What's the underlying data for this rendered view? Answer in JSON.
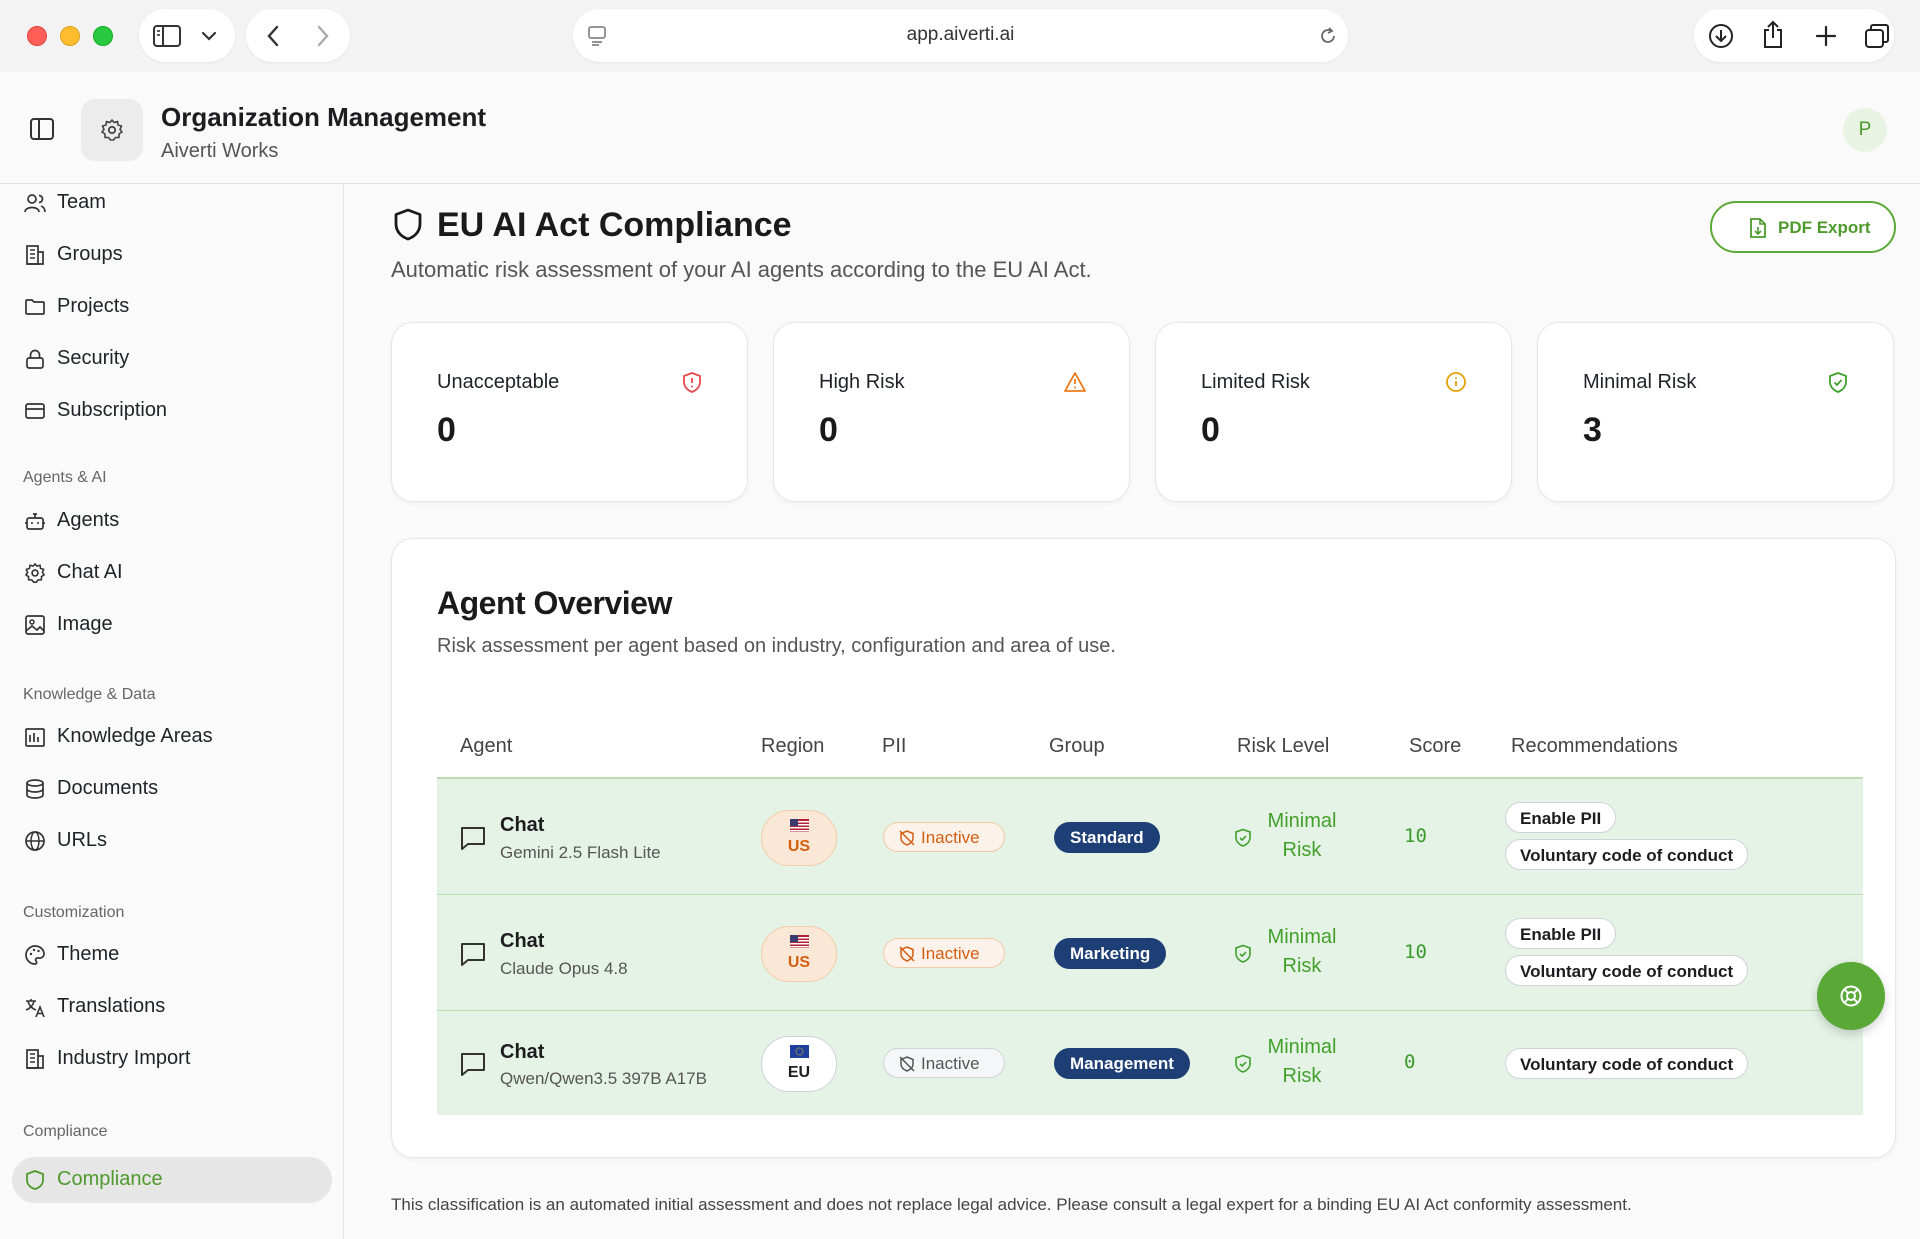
{
  "browser": {
    "url": "app.aiverti.ai"
  },
  "header": {
    "title": "Organization Management",
    "subtitle": "Aiverti Works",
    "avatar_initial": "P"
  },
  "sidebar": {
    "top_items": [
      {
        "label": "Team",
        "icon": "users-icon"
      },
      {
        "label": "Groups",
        "icon": "building-icon"
      },
      {
        "label": "Projects",
        "icon": "folder-icon"
      },
      {
        "label": "Security",
        "icon": "lock-icon"
      },
      {
        "label": "Subscription",
        "icon": "credit-card-icon"
      }
    ],
    "sections": [
      {
        "label": "Agents & AI",
        "items": [
          {
            "label": "Agents",
            "icon": "bot-icon"
          },
          {
            "label": "Chat AI",
            "icon": "gear-icon"
          },
          {
            "label": "Image",
            "icon": "image-icon"
          }
        ]
      },
      {
        "label": "Knowledge & Data",
        "items": [
          {
            "label": "Knowledge Areas",
            "icon": "library-icon"
          },
          {
            "label": "Documents",
            "icon": "database-icon"
          },
          {
            "label": "URLs",
            "icon": "globe-icon"
          }
        ]
      },
      {
        "label": "Customization",
        "items": [
          {
            "label": "Theme",
            "icon": "palette-icon"
          },
          {
            "label": "Translations",
            "icon": "translate-icon"
          },
          {
            "label": "Industry Import",
            "icon": "building-icon"
          }
        ]
      },
      {
        "label": "Compliance",
        "items": [
          {
            "label": "Compliance",
            "icon": "shield-icon",
            "active": true
          }
        ]
      }
    ]
  },
  "main": {
    "title": "EU AI Act Compliance",
    "subtitle": "Automatic risk assessment of your AI agents according to the EU AI Act.",
    "pdf_export_label": "PDF Export",
    "stats": [
      {
        "label": "Unacceptable",
        "value": "0",
        "icon": "shield-alert-icon",
        "color": "#e5484d"
      },
      {
        "label": "High Risk",
        "value": "0",
        "icon": "warning-icon",
        "color": "#f07a1a"
      },
      {
        "label": "Limited Risk",
        "value": "0",
        "icon": "info-icon",
        "color": "#e3a008"
      },
      {
        "label": "Minimal Risk",
        "value": "3",
        "icon": "shield-check-icon",
        "color": "#3fa02a"
      }
    ],
    "overview": {
      "title": "Agent Overview",
      "subtitle": "Risk assessment per agent based on industry, configuration and area of use.",
      "columns": [
        "Agent",
        "Region",
        "PII",
        "Group",
        "Risk Level",
        "Score",
        "Recommendations"
      ],
      "rows": [
        {
          "name": "Chat",
          "model": "Gemini 2.5 Flash Lite",
          "region": "US",
          "pii": "Inactive",
          "group": "Standard",
          "risk": [
            "Minimal",
            "Risk"
          ],
          "score": "10",
          "recommendations": [
            "Enable PII",
            "Voluntary code of conduct"
          ]
        },
        {
          "name": "Chat",
          "model": "Claude Opus 4.8",
          "region": "US",
          "pii": "Inactive",
          "group": "Marketing",
          "risk": [
            "Minimal",
            "Risk"
          ],
          "score": "10",
          "recommendations": [
            "Enable PII",
            "Voluntary code of conduct"
          ]
        },
        {
          "name": "Chat",
          "model": "Qwen/Qwen3.5 397B A17B",
          "region": "EU",
          "pii": "Inactive",
          "group": "Management",
          "risk": [
            "Minimal",
            "Risk"
          ],
          "score": "0",
          "recommendations": [
            "Voluntary code of conduct"
          ]
        }
      ]
    },
    "disclaimer": "This classification is an automated initial assessment and does not replace legal advice. Please consult a legal expert for a binding EU AI Act conformity assessment."
  },
  "colors": {
    "accent": "#5aa836",
    "row_bg": "#e5f3e6",
    "group_badge": "#1e3f75"
  }
}
